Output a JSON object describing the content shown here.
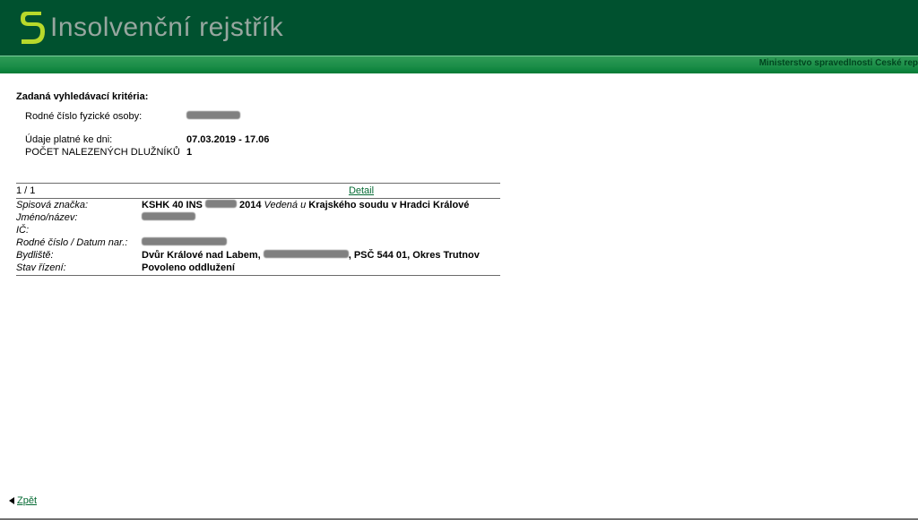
{
  "header": {
    "title": "Insolvenční rejstřík",
    "ministry": "Ministerstvo spravedlnosti České rep"
  },
  "criteria": {
    "heading": "Zadaná vyhledávací kritéria:",
    "rows": {
      "rodne_cislo_label": "Rodné číslo fyzické osoby:",
      "udaje_label": "Údaje platné ke dni:",
      "udaje_value": "07.03.2019 - 17.06",
      "pocet_label": "POČET NALEZENÝCH DLUŽNÍKŮ",
      "pocet_value": "1"
    }
  },
  "results": {
    "pager": "1 / 1",
    "detail_label": "Detail",
    "fields": {
      "spis_label": "Spisová značka:",
      "spis_prefix": "KSHK 40 INS",
      "spis_year": "2014",
      "spis_suffix_italic": " Vedená u ",
      "spis_court": "Krajského soudu v Hradci Králové",
      "jmeno_label": "Jméno/název:",
      "ic_label": "IČ:",
      "rc_label": "Rodné číslo / Datum nar.:",
      "bydliste_label": "Bydliště:",
      "bydliste_prefix": "Dvůr Králové nad Labem,",
      "bydliste_suffix": ", PSČ 544 01, Okres Trutnov",
      "stav_label": "Stav řízení:",
      "stav_value": "Povoleno oddlužení"
    }
  },
  "footer": {
    "back": "Zpět"
  }
}
